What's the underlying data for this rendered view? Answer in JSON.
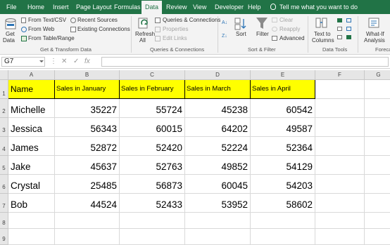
{
  "tabs": {
    "file": "File",
    "home": "Home",
    "insert": "Insert",
    "page_layout": "Page Layout",
    "formulas": "Formulas",
    "data": "Data",
    "review": "Review",
    "view": "View",
    "developer": "Developer",
    "help": "Help"
  },
  "tell_me": "Tell me what you want to do",
  "ribbon": {
    "get_data": "Get",
    "get_data2": "Data",
    "from_text": "From Text/CSV",
    "from_web": "From Web",
    "from_table": "From Table/Range",
    "recent_sources": "Recent Sources",
    "existing_connections": "Existing Connections",
    "group_get": "Get & Transform Data",
    "refresh": "Refresh",
    "refresh2": "All",
    "queries_connections": "Queries & Connections",
    "properties": "Properties",
    "edit_links": "Edit Links",
    "group_queries": "Queries & Connections",
    "sort": "Sort",
    "filter": "Filter",
    "clear": "Clear",
    "reapply": "Reapply",
    "advanced": "Advanced",
    "group_sort": "Sort & Filter",
    "text_to": "Text to",
    "columns": "Columns",
    "group_tools": "Data Tools",
    "what_if": "What-If",
    "analysis": "Analysis",
    "group_forecast": "Foreca"
  },
  "name_box": "G7",
  "formula_symbols": {
    "more": "⋮",
    "cancel": "✕",
    "enter": "✓",
    "fx": "fx"
  },
  "columns": [
    "A",
    "B",
    "C",
    "D",
    "E",
    "F",
    "G"
  ],
  "rows": [
    "1",
    "2",
    "3",
    "4",
    "5",
    "6",
    "7",
    "8",
    "9"
  ],
  "headers": [
    "Name",
    "Sales in January",
    "Sales in February",
    "Sales in March",
    "Sales in April"
  ],
  "data": [
    [
      "Michelle",
      "35227",
      "55724",
      "45238",
      "60542"
    ],
    [
      "Jessica",
      "56343",
      "60015",
      "64202",
      "49587"
    ],
    [
      "James",
      "52872",
      "52420",
      "52224",
      "52364"
    ],
    [
      "Jake",
      "45637",
      "52763",
      "49852",
      "54129"
    ],
    [
      "Crystal",
      "25485",
      "56873",
      "60045",
      "54203"
    ],
    [
      "Bob",
      "44524",
      "52433",
      "53952",
      "58602"
    ]
  ],
  "colors": {
    "excel_green": "#217346",
    "highlight": "#ffff00"
  }
}
